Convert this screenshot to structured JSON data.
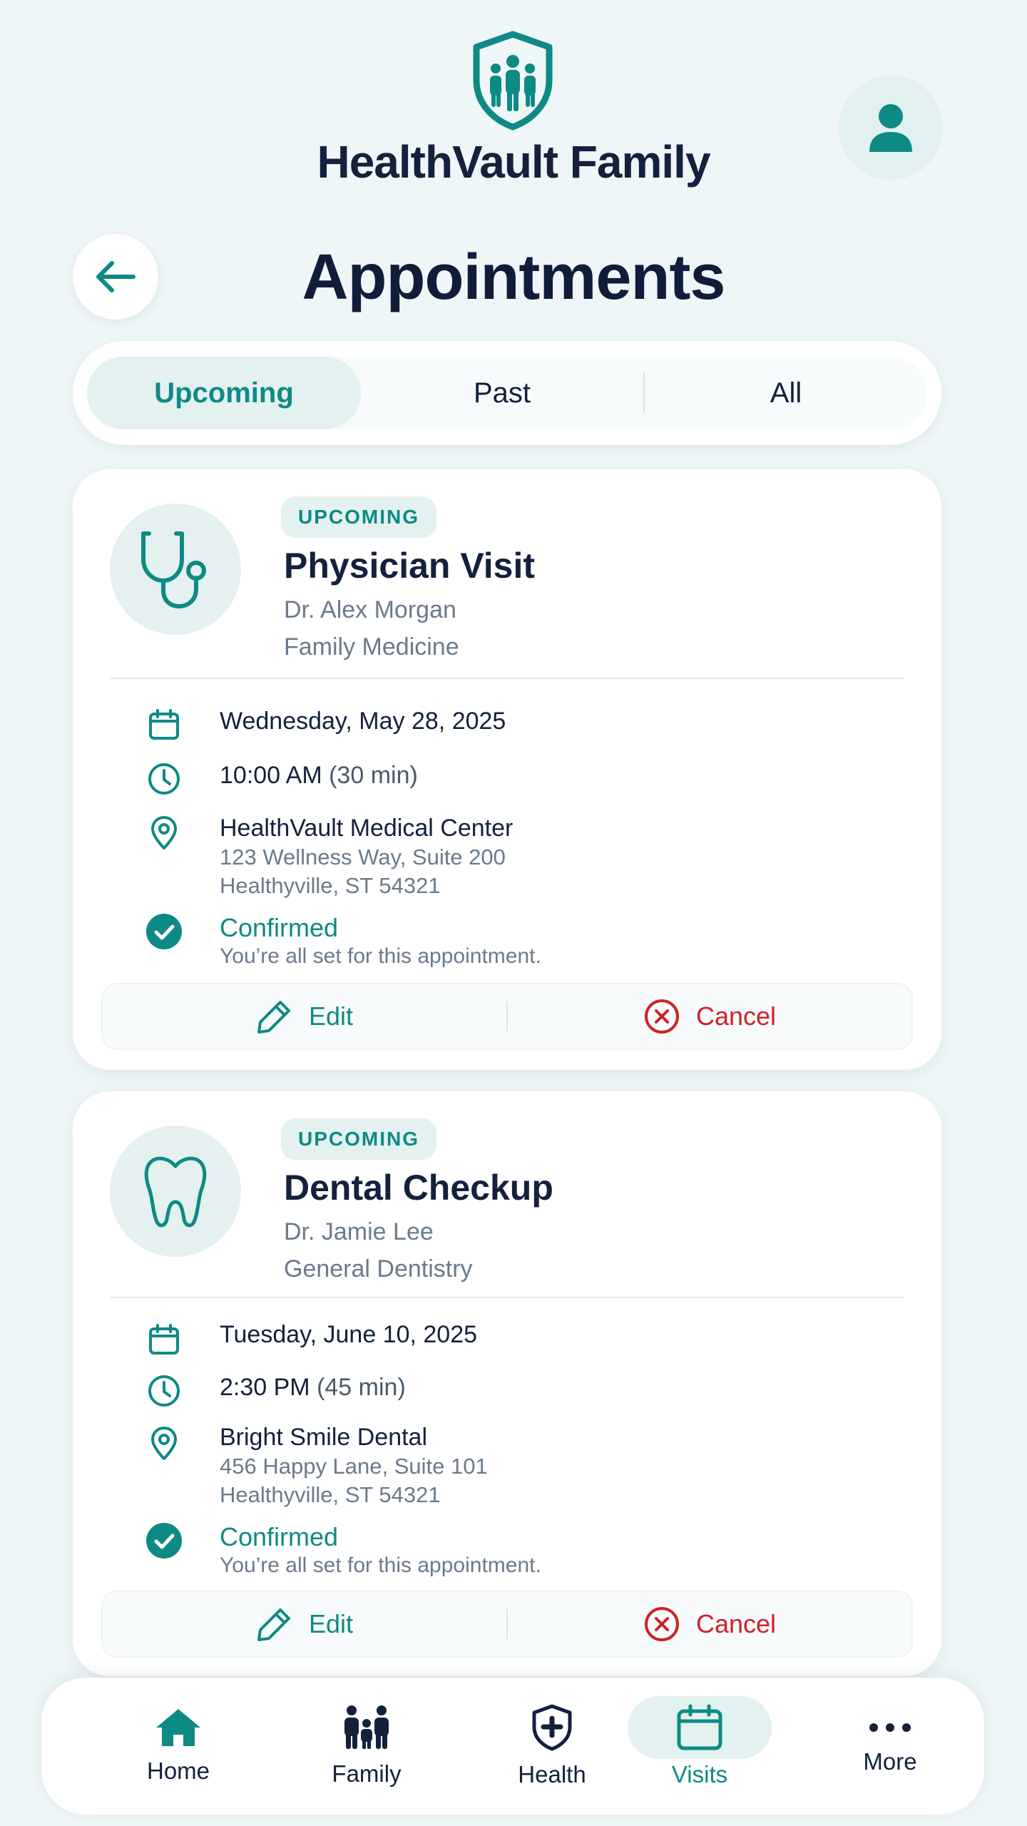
{
  "app": {
    "name": "HealthVault Family"
  },
  "icons": {
    "logo": "shield-family-icon",
    "profile": "user-icon",
    "back": "arrow-left-icon",
    "date": "calendar-icon",
    "time": "clock-icon",
    "location": "map-pin-icon",
    "status": "check-circle-icon",
    "edit": "pencil-icon",
    "cancel": "x-circle-icon"
  },
  "colors": {
    "accent": "#0e8a85",
    "danger": "#d0202a",
    "text_dark": "#14213d",
    "text_muted": "#6b7a8c",
    "background": "#eef6f7"
  },
  "page": {
    "title": "Appointments"
  },
  "tabs": [
    {
      "label": "Upcoming",
      "active": true
    },
    {
      "label": "Past",
      "active": false
    },
    {
      "label": "All",
      "active": false
    }
  ],
  "appointments": [
    {
      "status_badge": "UPCOMING",
      "icon": "stethoscope-icon",
      "title": "Physician Visit",
      "doctor": "Dr. Alex Morgan",
      "specialty": "Family Medicine",
      "date": "Wednesday, May 28, 2025",
      "time": "10:00 AM",
      "duration": "(30 min)",
      "location_name": "HealthVault Medical Center",
      "address_line1": "123 Wellness Way, Suite 200",
      "address_line2": "Healthyville, ST 54321",
      "confirmation_title": "Confirmed",
      "confirmation_note": "You’re all set for this appointment.",
      "edit_label": "Edit",
      "cancel_label": "Cancel"
    },
    {
      "status_badge": "UPCOMING",
      "icon": "tooth-icon",
      "title": "Dental Checkup",
      "doctor": "Dr. Jamie Lee",
      "specialty": "General Dentistry",
      "date": "Tuesday, June 10, 2025",
      "time": "2:30 PM",
      "duration": "(45 min)",
      "location_name": "Bright Smile Dental",
      "address_line1": "456 Happy Lane, Suite 101",
      "address_line2": "Healthyville, ST 54321",
      "confirmation_title": "Confirmed",
      "confirmation_note": "You’re all set for this appointment.",
      "edit_label": "Edit",
      "cancel_label": "Cancel"
    }
  ],
  "bottom_nav": [
    {
      "label": "Home",
      "icon": "home-icon",
      "active": false
    },
    {
      "label": "Family",
      "icon": "family-icon",
      "active": false
    },
    {
      "label": "Health",
      "icon": "shield-plus-icon",
      "active": false
    },
    {
      "label": "Visits",
      "icon": "calendar-icon",
      "active": true
    },
    {
      "label": "More",
      "icon": "more-dots-icon",
      "active": false
    }
  ]
}
